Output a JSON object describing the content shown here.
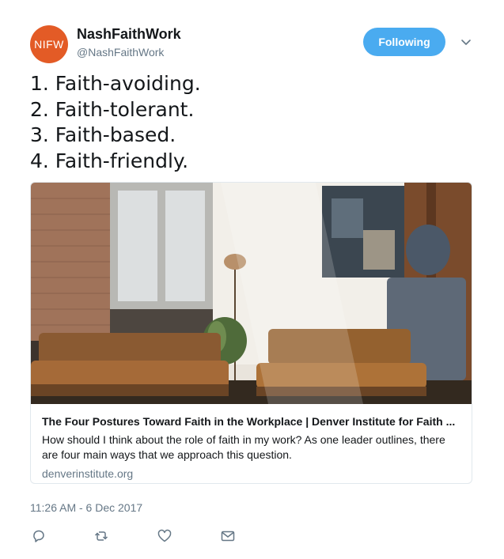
{
  "author": {
    "avatar_text": "NIFW",
    "avatar_color": "#e35b26",
    "display_name": "NashFaithWork",
    "handle": "@NashFaithWork"
  },
  "follow_button": {
    "label": "Following",
    "color": "#4aabf0"
  },
  "menu": {
    "icon": "chevron-down-icon"
  },
  "tweet": {
    "lines": [
      "1. Faith-avoiding.",
      "2. Faith-tolerant.",
      "3. Faith-based.",
      "4. Faith-friendly."
    ]
  },
  "link_card": {
    "image": "photo of a sunlit loft lounge with brick wall, windows, leather sofas, lamp, plant and a hat on a tote bag",
    "title": "The Four Postures Toward Faith in the Workplace | Denver Institute for Faith ...",
    "description": "How should I think about the role of faith in my work? As one leader outlines, there are four main ways that we approach this question.",
    "domain": "denverinstitute.org"
  },
  "timestamp": "11:26 AM - 6 Dec 2017",
  "actions": [
    {
      "name": "reply",
      "icon": "reply-icon"
    },
    {
      "name": "retweet",
      "icon": "retweet-icon"
    },
    {
      "name": "like",
      "icon": "heart-icon"
    },
    {
      "name": "direct-message",
      "icon": "envelope-icon"
    }
  ]
}
